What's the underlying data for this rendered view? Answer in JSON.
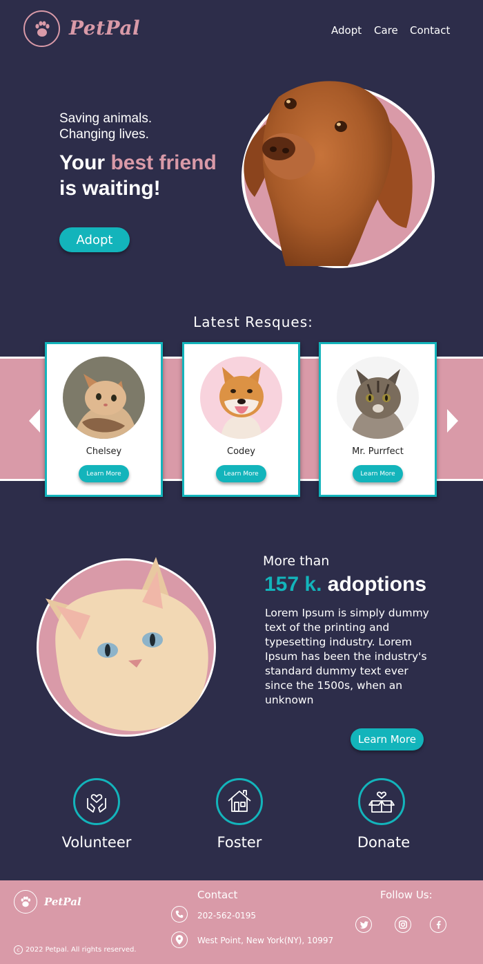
{
  "brand": {
    "name": "PetPal",
    "logo_icon": "paw-icon",
    "accent": "#d99aa8",
    "teal": "#13b4bb",
    "background": "#2d2d4a"
  },
  "nav": {
    "items": [
      "Adopt",
      "Care",
      "Contact"
    ]
  },
  "hero": {
    "tagline_1": "Saving animals.",
    "tagline_2": "Changing lives.",
    "headline_1_pre": "Your ",
    "headline_1_highlight": "best friend",
    "headline_2": "is waiting!",
    "cta_label": "Adopt"
  },
  "rescues": {
    "title": "Latest Resques:",
    "cards": [
      {
        "name": "Chelsey",
        "button": "Learn More"
      },
      {
        "name": "Codey",
        "button": "Learn More"
      },
      {
        "name": "Mr. Purrfect",
        "button": "Learn More"
      }
    ]
  },
  "stats": {
    "intro": "More than",
    "number": "157 k.",
    "label": " adoptions",
    "body": "Lorem Ipsum is simply dummy text of the printing and typesetting industry. Lorem Ipsum has been the industry's standard dummy text ever since the 1500s, when an unknown",
    "button": "Learn More"
  },
  "actions": [
    {
      "label": "Volunteer",
      "icon": "heart-hands-icon"
    },
    {
      "label": "Foster",
      "icon": "house-icon"
    },
    {
      "label": "Donate",
      "icon": "heart-box-icon"
    }
  ],
  "footer": {
    "brand": "PetPal",
    "contact_title": "Contact",
    "phone": "202-562-0195",
    "address": "West Point, New York(NY), 10997",
    "follow_title": "Follow Us:",
    "copyright": "2022 Petpal. All rights reserved.",
    "social": [
      "twitter-icon",
      "instagram-icon",
      "facebook-icon"
    ]
  }
}
